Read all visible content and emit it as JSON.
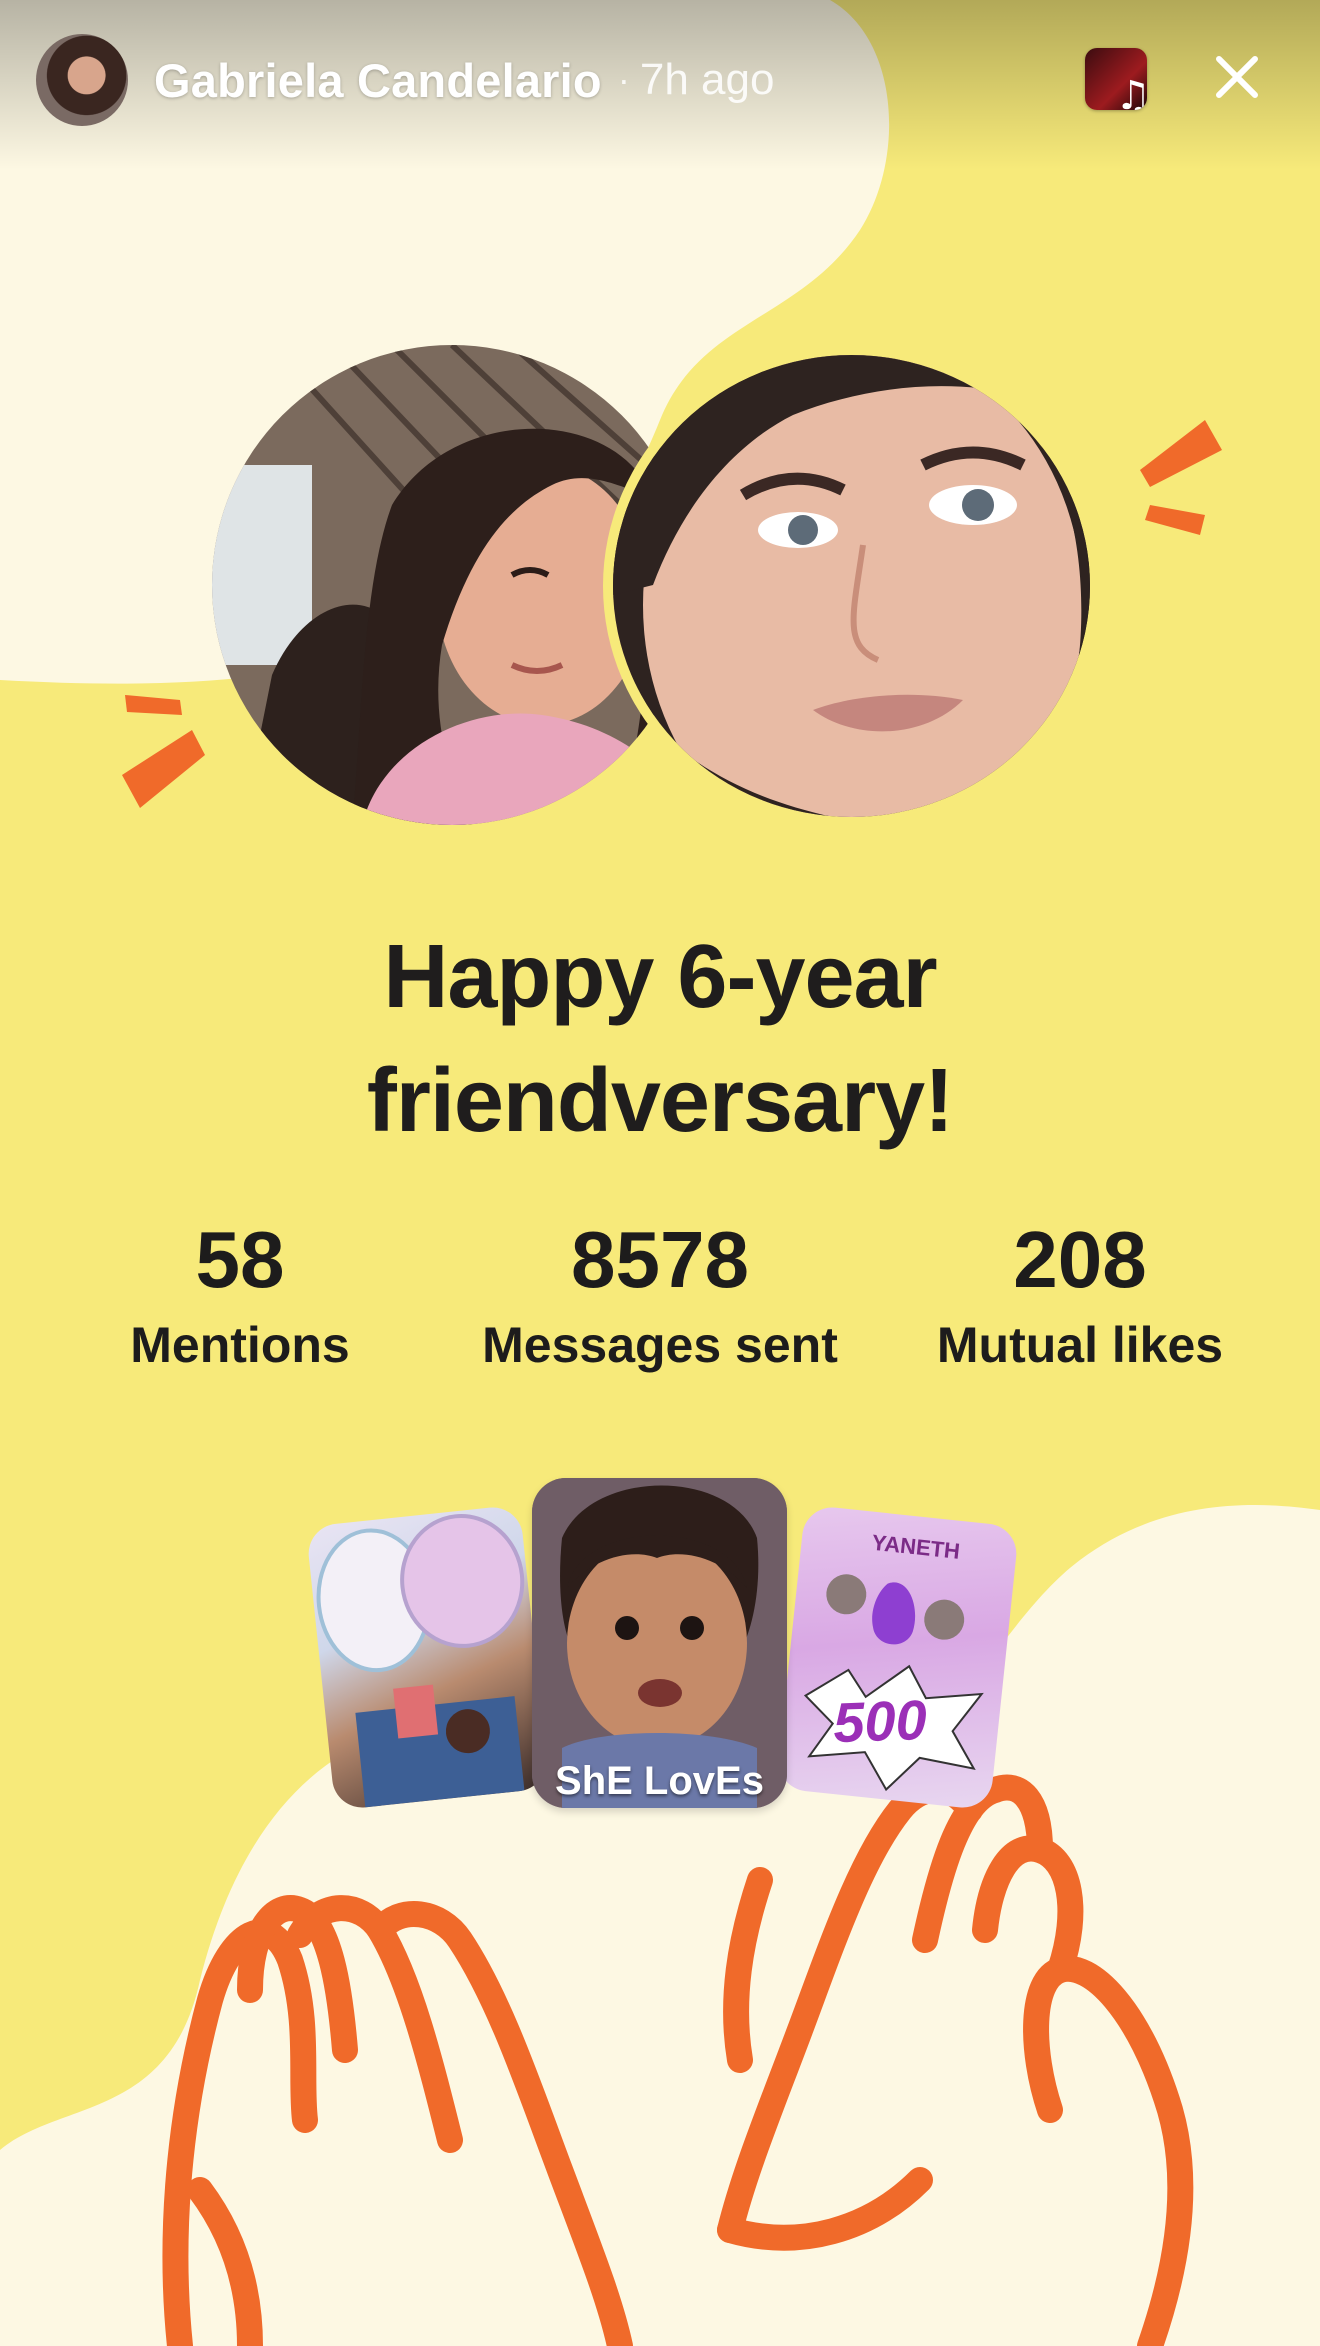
{
  "header": {
    "username": "Gabriela Candelario",
    "separator": "·",
    "time_ago": "7h ago",
    "music_icon": "music-note-icon",
    "close_icon": "close-icon"
  },
  "headline": {
    "line1": "Happy 6-year",
    "line2": "friendversary!"
  },
  "stats": [
    {
      "value": "58",
      "label": "Mentions"
    },
    {
      "value": "8578",
      "label": "Messages sent"
    },
    {
      "value": "208",
      "label": "Mutual likes"
    }
  ],
  "highlights": {
    "middle_caption": "ShE LovEs",
    "right_name": "YANETH",
    "right_number": "500"
  },
  "colors": {
    "background": "#f7ea7a",
    "cream": "#fdf8e3",
    "accent_orange": "#f06a2a",
    "text_dark": "#1f1d1d"
  }
}
